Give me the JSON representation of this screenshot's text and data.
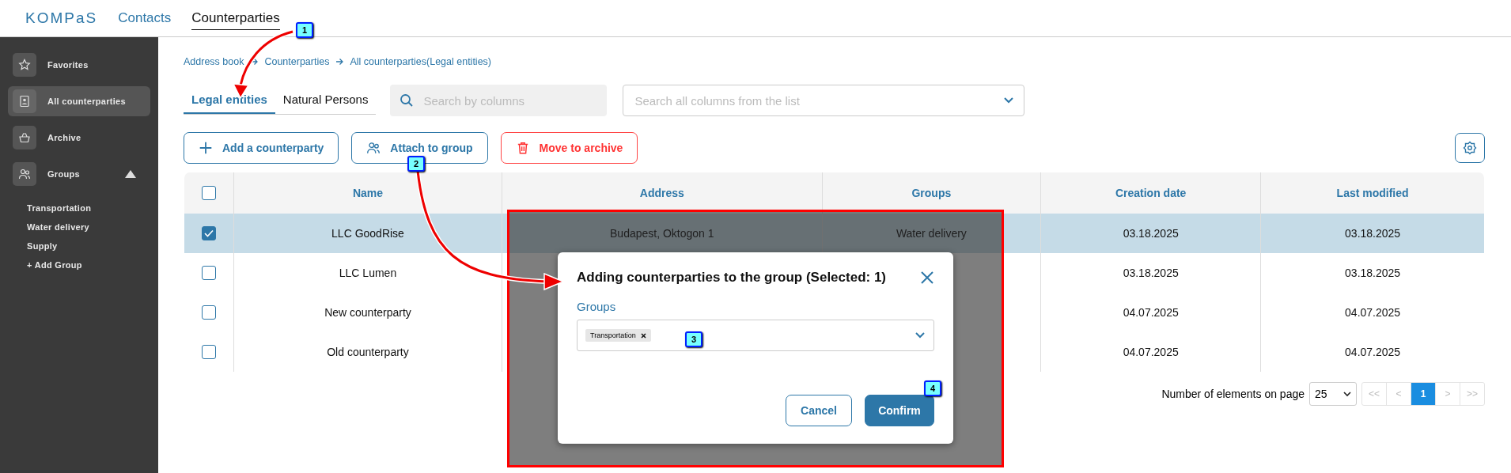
{
  "header": {
    "logo": "KOMPaS",
    "nav": [
      {
        "label": "Contacts",
        "selected": false
      },
      {
        "label": "Counterparties",
        "selected": true
      }
    ]
  },
  "sidebar": {
    "items": [
      {
        "label": "Favorites",
        "selected": false
      },
      {
        "label": "All counterparties",
        "selected": true
      },
      {
        "label": "Archive",
        "selected": false
      },
      {
        "label": "Groups",
        "selected": false,
        "expanded": true,
        "children": [
          {
            "label": "Transportation"
          },
          {
            "label": "Water delivery"
          },
          {
            "label": "Supply"
          },
          {
            "label": "+ Add Group"
          }
        ]
      }
    ]
  },
  "breadcrumb": [
    "Address book",
    "Counterparties",
    "All counterparties(Legal entities)"
  ],
  "tabs": [
    {
      "label": "Legal entities",
      "selected": true
    },
    {
      "label": "Natural Persons",
      "selected": false
    }
  ],
  "search": {
    "placeholder": "Search by columns"
  },
  "filter": {
    "placeholder": "Search all columns from the list"
  },
  "toolbar": [
    {
      "label": "Add a counterparty",
      "kind": "primary"
    },
    {
      "label": "Attach to group",
      "kind": "primary"
    },
    {
      "label": "Move to archive",
      "kind": "danger"
    }
  ],
  "table": {
    "columns": [
      "Name",
      "Address",
      "Groups",
      "Creation date",
      "Last modified"
    ],
    "header_checked": false,
    "rows": [
      {
        "checked": true,
        "selected": true,
        "cells": [
          "LLC GoodRise",
          "Budapest, Oktogon 1",
          "Water delivery",
          "03.18.2025",
          "03.18.2025"
        ]
      },
      {
        "checked": false,
        "selected": false,
        "cells": [
          "LLC Lumen",
          "",
          "",
          "03.18.2025",
          "03.18.2025"
        ]
      },
      {
        "checked": false,
        "selected": false,
        "cells": [
          "New counterparty",
          "",
          "",
          "04.07.2025",
          "04.07.2025"
        ]
      },
      {
        "checked": false,
        "selected": false,
        "cells": [
          "Old counterparty",
          "",
          "",
          "04.07.2025",
          "04.07.2025"
        ]
      }
    ]
  },
  "pagination": {
    "label": "Number of elements on page",
    "page_size": "25",
    "pages": [
      {
        "label": "<<",
        "selected": false
      },
      {
        "label": "<",
        "selected": false
      },
      {
        "label": "1",
        "selected": true
      },
      {
        "label": ">",
        "selected": false
      },
      {
        "label": ">>",
        "selected": false
      }
    ]
  },
  "dialog": {
    "title": "Adding counterparties to the group (Selected: 1)",
    "field_label": "Groups",
    "chips": [
      "Transportation"
    ],
    "buttons": [
      {
        "label": "Cancel",
        "kind": "secondary"
      },
      {
        "label": "Confirm",
        "kind": "primary"
      }
    ]
  },
  "annotations": [
    {
      "label": "1"
    },
    {
      "label": "2"
    },
    {
      "label": "3"
    },
    {
      "label": "4"
    }
  ]
}
